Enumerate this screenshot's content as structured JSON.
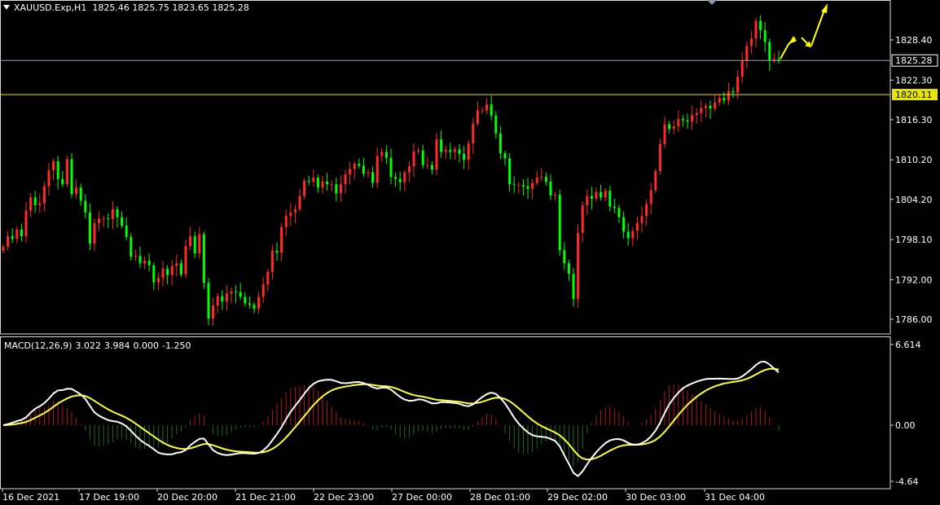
{
  "header": {
    "symbol": "XAUUSD.Exp,H1",
    "open": "1825.46",
    "high": "1825.75",
    "low": "1823.65",
    "close": "1825.28"
  },
  "macd": {
    "label": "MACD(12,26,9)",
    "v1": "3.022",
    "v2": "3.984",
    "v3": "0.000",
    "v4": "-1.250"
  },
  "colors": {
    "background": "#000000",
    "bull": "#ff2a2a",
    "bear": "#00ff00",
    "price_line": "#9aa0a8",
    "level_line": "#e5e500",
    "macd_main": "#ffffff",
    "macd_signal": "#ffff33",
    "arrows": "#ffff00"
  },
  "chart_data": [
    {
      "type": "candlestick",
      "title": "",
      "y_ticks": [
        "1828.40",
        "1822.30",
        "1816.30",
        "1810.20",
        "1804.20",
        "1798.10",
        "1792.00",
        "1786.00"
      ],
      "ylim": [
        1784.5,
        1833.5
      ],
      "x_ticks": [
        "16 Dec 2021",
        "17 Dec 19:00",
        "20 Dec 20:00",
        "21 Dec 21:00",
        "22 Dec 23:00",
        "27 Dec 00:00",
        "28 Dec 01:00",
        "29 Dec 02:00",
        "30 Dec 03:00",
        "31 Dec 04:00"
      ],
      "current_price": "1825.28",
      "level": "1820.11",
      "closes": [
        1797,
        1798.6,
        1798.2,
        1799.6,
        1798.6,
        1802.5,
        1804.5,
        1803.3,
        1803.6,
        1806.2,
        1808.6,
        1810,
        1807.3,
        1806.5,
        1810.3,
        1805,
        1806,
        1804,
        1802.2,
        1797.5,
        1800.6,
        1801.3,
        1801.3,
        1801.2,
        1802.7,
        1801.5,
        1800.2,
        1798.5,
        1795.5,
        1795.6,
        1794.5,
        1794.9,
        1794.2,
        1791.6,
        1792.3,
        1793.7,
        1792.7,
        1794.1,
        1794.5,
        1792.8,
        1797.1,
        1798.6,
        1796,
        1798.9,
        1791.5,
        1786.1,
        1788.1,
        1789.5,
        1788.7,
        1789.9,
        1790.2,
        1790.1,
        1789.4,
        1788.4,
        1788.2,
        1787.6,
        1789.4,
        1791.3,
        1793.2,
        1796.4,
        1796.1,
        1800,
        1801.7,
        1802.2,
        1802.7,
        1804.7,
        1807,
        1806.9,
        1807.5,
        1806,
        1806.9,
        1806.5,
        1806.5,
        1805.1,
        1806.5,
        1808,
        1808.8,
        1809.6,
        1809.3,
        1808.1,
        1808.3,
        1806.7,
        1810.8,
        1811.4,
        1810.5,
        1807.6,
        1807.3,
        1806.8,
        1808.3,
        1809.2,
        1811.5,
        1811.6,
        1809.4,
        1809.4,
        1808.7,
        1813.3,
        1811.4,
        1811.7,
        1811.4,
        1811.8,
        1811.1,
        1810.2,
        1812.7,
        1815.7,
        1817.7,
        1817.7,
        1818.6,
        1816.9,
        1814.2,
        1811.2,
        1810.4,
        1806.5,
        1806.4,
        1806.4,
        1806.2,
        1805.8,
        1806.7,
        1807.5,
        1807.6,
        1806.9,
        1804.8,
        1804.9,
        1796.5,
        1794.5,
        1792.9,
        1789.1,
        1799.1,
        1803.3,
        1804.7,
        1804.3,
        1805.3,
        1804.5,
        1805.5,
        1803.1,
        1802.9,
        1801.5,
        1799.3,
        1798.3,
        1799.4,
        1800.6,
        1801.7,
        1803.5,
        1805.6,
        1808.5,
        1812.6,
        1815.6,
        1814.9,
        1815.3,
        1816.4,
        1816.2,
        1816,
        1817,
        1817.3,
        1818.1,
        1818.4,
        1818,
        1818.9,
        1819.6,
        1819.2,
        1820.6,
        1820.4,
        1822.8,
        1825.2,
        1827.5,
        1828.6,
        1831.3,
        1829.9,
        1828.1,
        1825.3,
        1825.5,
        1825.28
      ]
    },
    {
      "type": "line",
      "title": "MACD(12,26,9)",
      "y_ticks": [
        "6.614",
        "0.00",
        "-4.64"
      ],
      "ylim": [
        -4.64,
        6.614
      ],
      "series": [
        {
          "name": "MACD",
          "values": []
        },
        {
          "name": "Signal",
          "values": []
        }
      ]
    }
  ]
}
